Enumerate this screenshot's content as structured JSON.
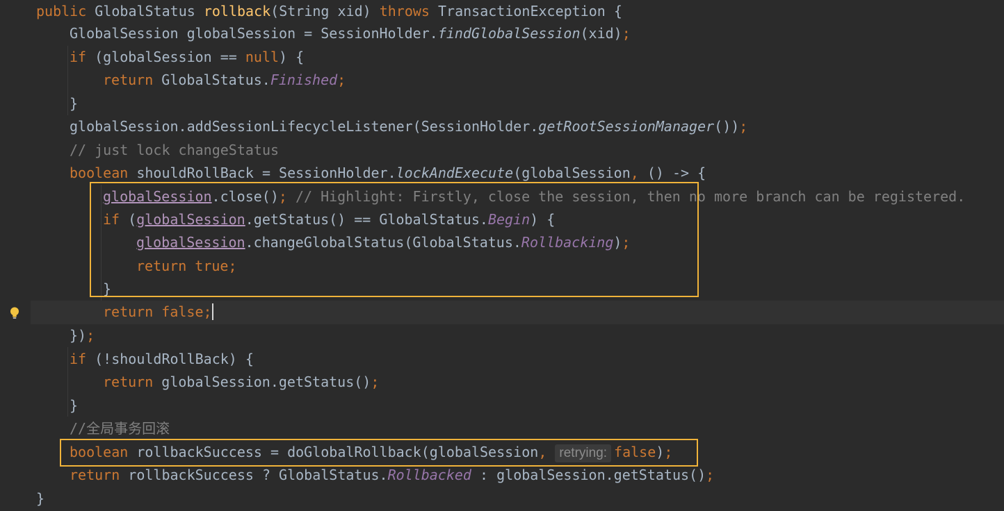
{
  "editor": {
    "colors": {
      "background": "#2b2b2b",
      "keyword": "#cc7832",
      "method_declaration": "#ffc66d",
      "constant": "#9876aa",
      "comment": "#808080",
      "plain": "#a9b7c6",
      "highlight_box": "#f0b33a"
    },
    "gutter_icon": "lightbulb-icon",
    "lines": [
      {
        "segments": [
          "public",
          " GlobalStatus ",
          "rollback",
          "(String xid) ",
          "throws",
          " TransactionException {"
        ]
      },
      {
        "segments": [
          "GlobalSession globalSession = SessionHolder.",
          "findGlobalSession",
          "(xid)",
          ";"
        ]
      },
      {
        "segments": [
          "if",
          " (globalSession == ",
          "null",
          ") {"
        ]
      },
      {
        "segments": [
          "return",
          " GlobalStatus.",
          "Finished",
          ";"
        ]
      },
      {
        "segments": [
          "}"
        ]
      },
      {
        "segments": [
          "globalSession.addSessionLifecycleListener(SessionHolder.",
          "getRootSessionManager",
          "())",
          ";"
        ]
      },
      {
        "segments": [
          "// just lock changeStatus"
        ]
      },
      {
        "segments": [
          "boolean",
          " shouldRollBack = SessionHolder.",
          "lockAndExecute",
          "(globalSession",
          ",",
          " () -> {"
        ]
      },
      {
        "segments": [
          "globalSession",
          ".close()",
          ";",
          " // Highlight: Firstly, close the session, then no more branch can be registered."
        ]
      },
      {
        "segments": [
          "if",
          " (",
          "globalSession",
          ".getStatus() == GlobalStatus.",
          "Begin",
          ") {"
        ]
      },
      {
        "segments": [
          "globalSession",
          ".changeGlobalStatus(GlobalStatus.",
          "Rollbacking",
          ")",
          ";"
        ]
      },
      {
        "segments": [
          "return",
          " ",
          "true",
          ";"
        ]
      },
      {
        "segments": [
          "}"
        ]
      },
      {
        "segments": [
          "return",
          " ",
          "false",
          ";"
        ]
      },
      {
        "segments": [
          "})",
          ";"
        ]
      },
      {
        "segments": [
          "if",
          " (!shouldRollBack) {"
        ]
      },
      {
        "segments": [
          "return",
          " globalSession.getStatus()",
          ";"
        ]
      },
      {
        "segments": [
          "}"
        ]
      },
      {
        "segments": [
          "//全局事务回滚"
        ]
      },
      {
        "segments": [
          "boolean",
          " rollbackSuccess = doGlobalRollback(globalSession",
          ",",
          "retrying:",
          "false",
          ")",
          ";"
        ]
      },
      {
        "segments": [
          "return",
          " rollbackSuccess ? GlobalStatus.",
          "Rollbacked",
          " : globalSession.getStatus()",
          ";"
        ]
      },
      {
        "segments": [
          "}"
        ]
      }
    ]
  }
}
